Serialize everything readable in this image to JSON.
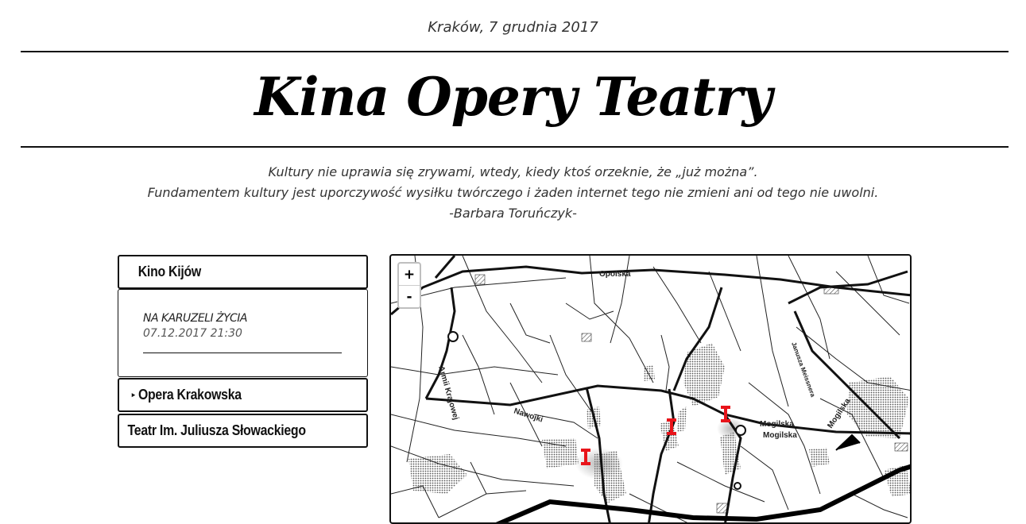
{
  "header": {
    "dateline": "Kraków, 7 grudnia 2017",
    "title": "Kina Opery Teatry"
  },
  "quote": {
    "line1": "Kultury nie uprawia się zrywami, wtedy, kiedy ktoś orzeknie, że „już można”.",
    "line2": "Fundamentem kultury jest uporczywość wysiłku twórczego i żaden internet tego nie zmieni ani od tego nie uwolni.",
    "author": "-Barbara Toruńczyk-"
  },
  "venues": [
    {
      "name": "Kino Kijów",
      "expanded": true
    },
    {
      "name": "Opera Krakowska",
      "expanded": false,
      "caret": "▸"
    },
    {
      "name": "Teatr Im. Juliusza Słowackiego",
      "expanded": false
    }
  ],
  "events": [
    {
      "title": "NA KARUZELI ŻYCIA",
      "datetime": "07.12.2017 21:30"
    }
  ],
  "map": {
    "zoom_in": "+",
    "zoom_out": "-",
    "street_labels": [
      "Opolska",
      "Armii Krajowej",
      "Nawojki",
      "Mogilska",
      "Mogilska",
      "Mogilska",
      "Janusza Meissnera"
    ],
    "marker_color": "#e8141a",
    "marker_count": 3
  }
}
